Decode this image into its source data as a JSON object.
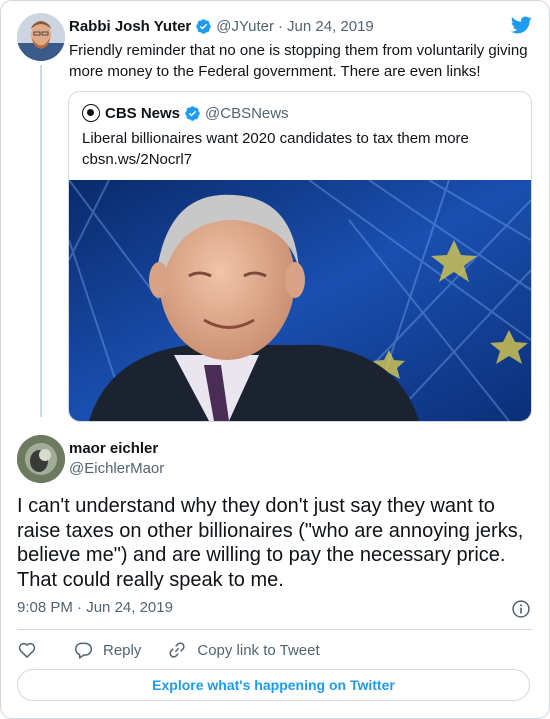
{
  "parent_tweet": {
    "author_name": "Rabbi Josh Yuter",
    "handle": "@JYuter",
    "date": "Jun 24, 2019",
    "text": "Friendly reminder that no one is stopping them from voluntarily giving more money to the Federal government. There are even links!"
  },
  "quoted_tweet": {
    "author_name": "CBS News",
    "handle": "@CBSNews",
    "text_line1": "Liberal billionaires want 2020 candidates to tax them more",
    "link": "cbsn.ws/2Nocrl7"
  },
  "main_tweet": {
    "author_name": "maor eichler",
    "handle": "@EichlerMaor",
    "text": "I can't understand why they don't just say they want to raise taxes on other billionaires (\"who are annoying jerks, believe me\") and are willing to pay the necessary price. That could really speak to me.",
    "time": "9:08 PM",
    "date": "Jun 24, 2019"
  },
  "actions": {
    "reply_label": "Reply",
    "copy_label": "Copy link to Tweet"
  },
  "footer": {
    "explore_label": "Explore what's happening on Twitter"
  },
  "icons": [
    "verified-icon",
    "twitter-bird-icon",
    "cbs-eye-icon",
    "info-icon",
    "heart-icon",
    "reply-icon",
    "link-icon"
  ],
  "colors": {
    "accent": "#1d9bf0",
    "muted_text": "#536471",
    "border": "#cfd9de"
  }
}
